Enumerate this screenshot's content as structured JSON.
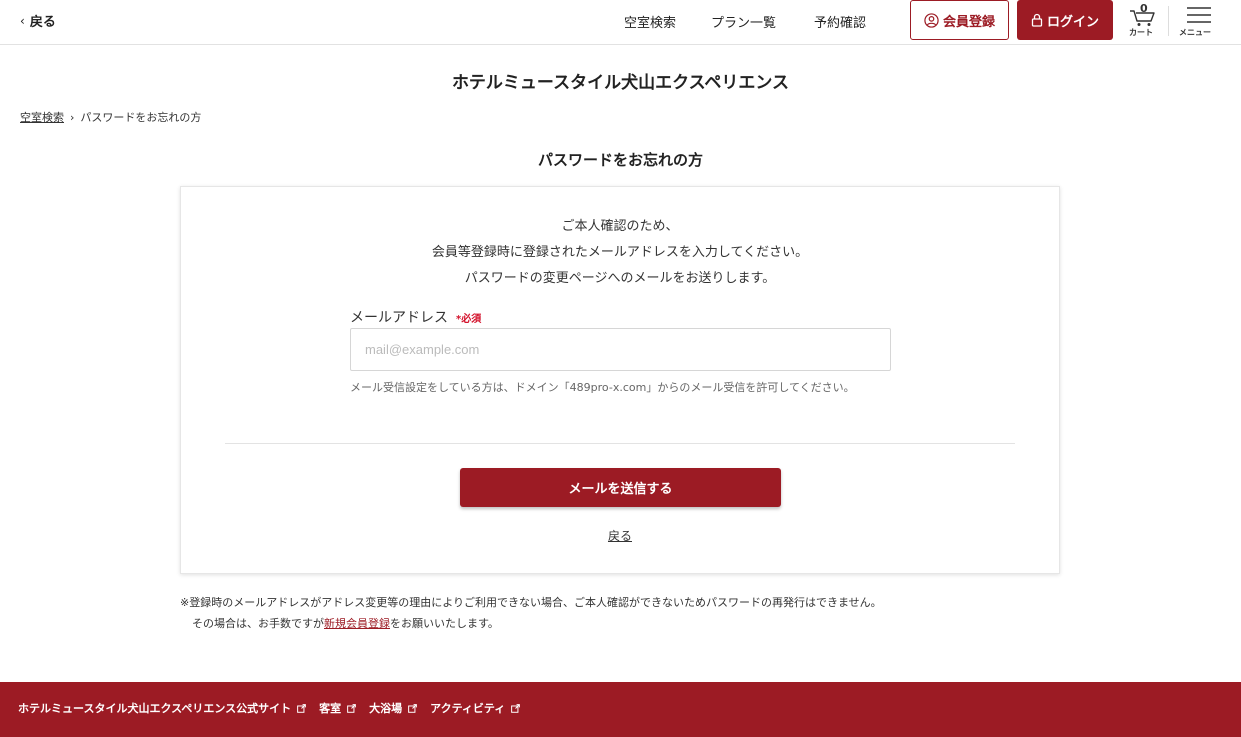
{
  "header": {
    "back_label": "戻る",
    "nav": [
      "空室検索",
      "プラン一覧",
      "予約確認"
    ],
    "register_label": "会員登録",
    "login_label": "ログイン",
    "cart_count": "0",
    "cart_label": "カート",
    "menu_label": "メニュー"
  },
  "hotel_title": "ホテルミュースタイル犬山エクスペリエンス",
  "breadcrumb": {
    "home": "空室検索",
    "current": "パスワードをお忘れの方"
  },
  "page_heading": "パスワードをお忘れの方",
  "form": {
    "intro_lines": [
      "ご本人確認のため、",
      "会員等登録時に登録されたメールアドレスを入力してください。",
      "パスワードの変更ページへのメールをお送りします。"
    ],
    "email_label": "メールアドレス",
    "required_label": "*必須",
    "email_placeholder": "mail@example.com",
    "email_value": "",
    "note": "メール受信設定をしている方は、ドメイン「489pro-x.com」からのメール受信を許可してください。",
    "send_button": "メールを送信する",
    "back_link": "戻る"
  },
  "notice": {
    "line1": "※登録時のメールアドレスがアドレス変更等の理由によりご利用できない場合、ご本人確認ができないためパスワードの再発行はできません。",
    "line2_prefix": "その場合は、お手数ですが",
    "line2_link": "新規会員登録",
    "line2_suffix": "をお願いいたします。"
  },
  "footer": {
    "links": [
      "ホテルミュースタイル犬山エクスペリエンス公式サイト",
      "客室",
      "大浴場",
      "アクティビティ"
    ]
  },
  "colors": {
    "brand": "#9c1b24",
    "required": "#d3102a"
  }
}
